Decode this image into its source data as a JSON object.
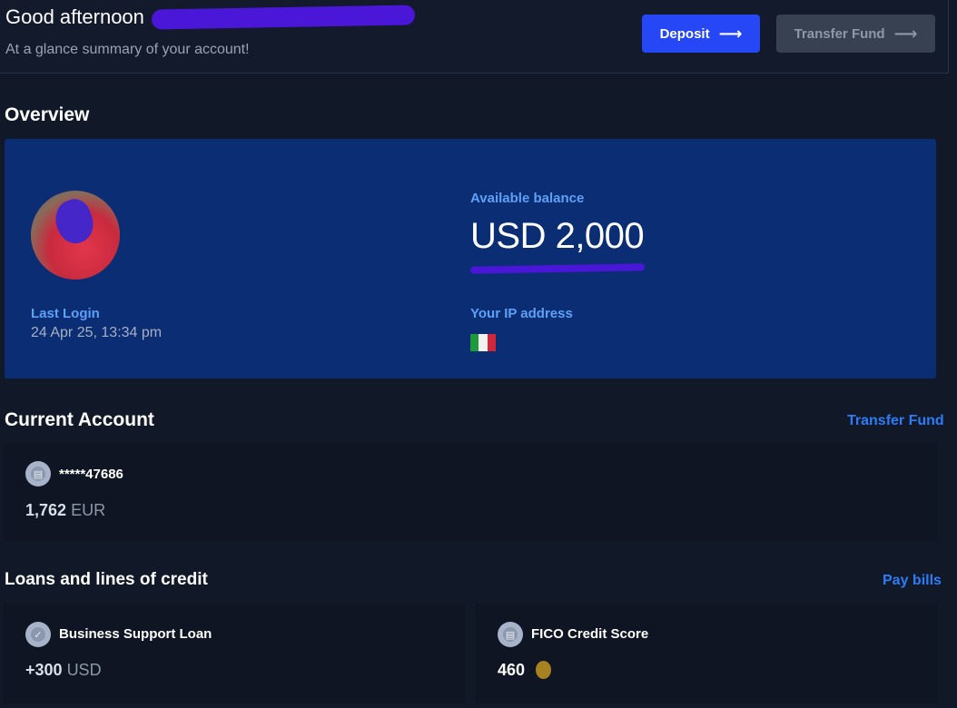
{
  "header": {
    "greeting": "Good afternoon",
    "subtitle": "At a glance summary of your account!",
    "deposit_label": "Deposit",
    "transfer_label": "Transfer Fund",
    "arrow_glyph": "⟶"
  },
  "overview": {
    "title": "Overview",
    "last_login_label": "Last Login",
    "last_login_value": "24 Apr 25, 13:34 pm",
    "balance_label": "Available balance",
    "balance_value": "USD 2,000",
    "ip_label": "Your IP address",
    "ip_flag": "italy-flag-icon"
  },
  "current_account": {
    "title": "Current Account",
    "link": "Transfer Fund",
    "account_number": "*****47686",
    "amount": "1,762",
    "currency": "EUR"
  },
  "loans": {
    "title": "Loans and lines of credit",
    "link": "Pay bills",
    "items": [
      {
        "name": "Business Support Loan",
        "amount": "+300",
        "currency": "USD",
        "icon": "check-circle-icon"
      },
      {
        "name": "FICO Credit Score",
        "amount": "460",
        "icon": "credit-card-icon"
      }
    ]
  },
  "colors": {
    "background": "#111827",
    "overview_card": "#0b2d73",
    "primary_button": "#2647f5",
    "link": "#2d7cf6",
    "label_blue": "#5fa0f5"
  }
}
